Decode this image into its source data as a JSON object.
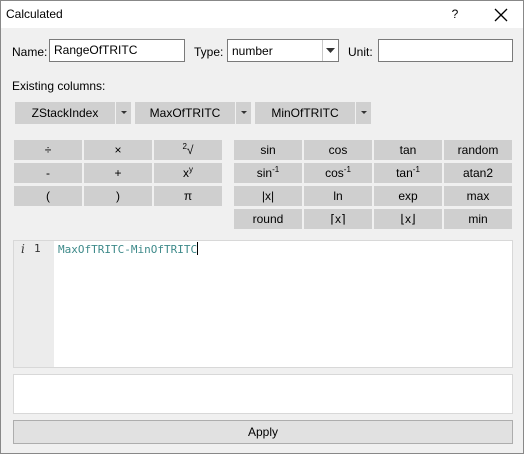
{
  "window": {
    "title": "Calculated",
    "help_label": "?"
  },
  "form": {
    "name_label": "Name:",
    "name_value": "RangeOfTRITC",
    "type_label": "Type:",
    "type_value": "number",
    "unit_label": "Unit:",
    "unit_value": ""
  },
  "existing_columns": {
    "label": "Existing columns:",
    "columns": [
      "ZStackIndex",
      "MaxOfTRITC",
      "MinOfTRITC"
    ]
  },
  "operators": {
    "divide": "÷",
    "multiply": "×",
    "root": "√",
    "root_index": "2",
    "minus": "-",
    "plus": "+",
    "power_base": "x",
    "power_exp": "y",
    "open_paren": "(",
    "close_paren": ")",
    "pi": "π"
  },
  "functions": {
    "sin": "sin",
    "cos": "cos",
    "tan": "tan",
    "random": "random",
    "asin": "sin",
    "acos": "cos",
    "atan": "tan",
    "inverse_exp": "-1",
    "atan2": "atan2",
    "abs": "|x|",
    "ln": "ln",
    "exp": "exp",
    "max": "max",
    "round": "round",
    "ceil": "⌈x⌉",
    "floor": "⌊x⌋",
    "min": "min"
  },
  "editor": {
    "info_marker": "i",
    "line_number": "1",
    "expression": "MaxOfTRITC-MinOfTRITC"
  },
  "output": {
    "text": ""
  },
  "apply_label": "Apply"
}
